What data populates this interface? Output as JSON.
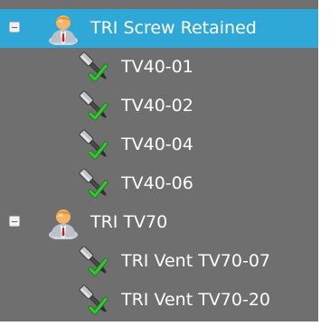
{
  "tree": {
    "groups": [
      {
        "label": "TRI Screw Retained",
        "expanded": true,
        "selected": true,
        "icon": "user-icon",
        "children": [
          {
            "label": "TV40-01",
            "icon": "screwdriver-check-icon"
          },
          {
            "label": "TV40-02",
            "icon": "screwdriver-check-icon"
          },
          {
            "label": "TV40-04",
            "icon": "screwdriver-check-icon"
          },
          {
            "label": "TV40-06",
            "icon": "screwdriver-check-icon"
          }
        ]
      },
      {
        "label": "TRI TV70",
        "expanded": true,
        "selected": false,
        "icon": "user-icon",
        "children": [
          {
            "label": "TRI Vent TV70-07",
            "icon": "screwdriver-check-icon"
          },
          {
            "label": "TRI Vent TV70-20",
            "icon": "screwdriver-check-icon"
          }
        ]
      }
    ]
  },
  "colors": {
    "panel_background": "#6f6f6f",
    "selection": "#2fa8d8",
    "text": "#ffffff",
    "check": "#33c933"
  }
}
